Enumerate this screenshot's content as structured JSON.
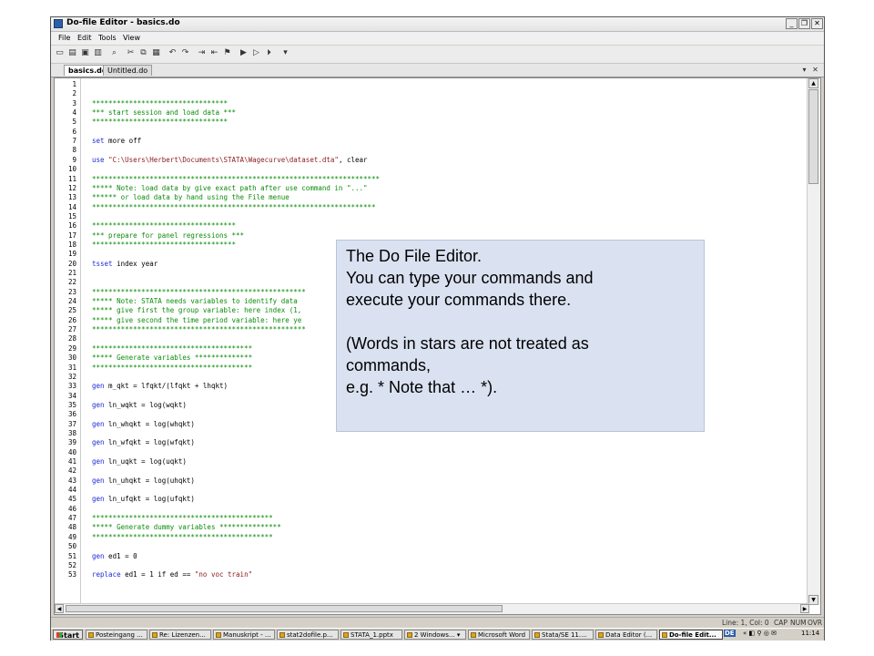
{
  "window": {
    "title": "Do-file Editor - basics.do",
    "min_label": "_",
    "restore_label": "❐",
    "close_label": "✕"
  },
  "menu": [
    "File",
    "Edit",
    "Tools",
    "View"
  ],
  "tabs": [
    {
      "label": "basics.do",
      "active": true
    },
    {
      "label": "Untitled.do",
      "active": false
    }
  ],
  "tab_controls": {
    "dropdown": "▾",
    "close": "✕"
  },
  "code_lines": [
    {
      "n": "1",
      "t": "",
      "type": "blank"
    },
    {
      "n": "2",
      "t": "",
      "type": "blank"
    },
    {
      "n": "3",
      "t": "*********************************",
      "type": "comment"
    },
    {
      "n": "4",
      "t": "*** start session and load data ***",
      "type": "comment"
    },
    {
      "n": "5",
      "t": "*********************************",
      "type": "comment"
    },
    {
      "n": "6",
      "t": "",
      "type": "blank"
    },
    {
      "n": "7",
      "t": "set more off",
      "type": "code",
      "kw": "set"
    },
    {
      "n": "8",
      "t": "",
      "type": "blank"
    },
    {
      "n": "9",
      "t": "use \"C:\\Users\\Herbert\\Documents\\STATA\\Wagecurve\\dataset.dta\", clear",
      "type": "code",
      "kw": "use"
    },
    {
      "n": "10",
      "t": "",
      "type": "blank"
    },
    {
      "n": "11",
      "t": "**********************************************************************",
      "type": "comment"
    },
    {
      "n": "12",
      "t": "***** Note: load data by give exact path after use command in \"...\"",
      "type": "comment"
    },
    {
      "n": "13",
      "t": "****** or load data by hand using the File menue",
      "type": "comment"
    },
    {
      "n": "14",
      "t": "*********************************************************************",
      "type": "comment"
    },
    {
      "n": "15",
      "t": "",
      "type": "blank"
    },
    {
      "n": "16",
      "t": "***********************************",
      "type": "comment"
    },
    {
      "n": "17",
      "t": "*** prepare for panel regressions ***",
      "type": "comment"
    },
    {
      "n": "18",
      "t": "***********************************",
      "type": "comment"
    },
    {
      "n": "19",
      "t": "",
      "type": "blank"
    },
    {
      "n": "20",
      "t": "tsset index year",
      "type": "code",
      "kw": "tsset"
    },
    {
      "n": "21",
      "t": "",
      "type": "blank"
    },
    {
      "n": "22",
      "t": "",
      "type": "blank"
    },
    {
      "n": "23",
      "t": "****************************************************",
      "type": "comment"
    },
    {
      "n": "24",
      "t": "***** Note: STATA needs variables to identify data",
      "type": "comment"
    },
    {
      "n": "25",
      "t": "***** give first the group variable: here index (1,",
      "type": "comment"
    },
    {
      "n": "26",
      "t": "***** give second the time period variable: here ye",
      "type": "comment"
    },
    {
      "n": "27",
      "t": "****************************************************",
      "type": "comment"
    },
    {
      "n": "28",
      "t": "",
      "type": "blank"
    },
    {
      "n": "29",
      "t": "***************************************",
      "type": "comment"
    },
    {
      "n": "30",
      "t": "***** Generate variables **************",
      "type": "comment"
    },
    {
      "n": "31",
      "t": "***************************************",
      "type": "comment"
    },
    {
      "n": "32",
      "t": "",
      "type": "blank"
    },
    {
      "n": "33",
      "t": "gen m_qkt = lfqkt/(lfqkt + lhqkt)",
      "type": "code",
      "kw": "gen"
    },
    {
      "n": "34",
      "t": "",
      "type": "blank"
    },
    {
      "n": "35",
      "t": "gen ln_wqkt = log(wqkt)",
      "type": "code",
      "kw": "gen"
    },
    {
      "n": "36",
      "t": "",
      "type": "blank"
    },
    {
      "n": "37",
      "t": "gen ln_whqkt = log(whqkt)",
      "type": "code",
      "kw": "gen"
    },
    {
      "n": "38",
      "t": "",
      "type": "blank"
    },
    {
      "n": "39",
      "t": "gen ln_wfqkt = log(wfqkt)",
      "type": "code",
      "kw": "gen"
    },
    {
      "n": "40",
      "t": "",
      "type": "blank"
    },
    {
      "n": "41",
      "t": "gen ln_uqkt = log(uqkt)",
      "type": "code",
      "kw": "gen"
    },
    {
      "n": "42",
      "t": "",
      "type": "blank"
    },
    {
      "n": "43",
      "t": "gen ln_uhqkt = log(uhqkt)",
      "type": "code",
      "kw": "gen"
    },
    {
      "n": "44",
      "t": "",
      "type": "blank"
    },
    {
      "n": "45",
      "t": "gen ln_ufqkt = log(ufqkt)",
      "type": "code",
      "kw": "gen"
    },
    {
      "n": "46",
      "t": "",
      "type": "blank"
    },
    {
      "n": "47",
      "t": "********************************************",
      "type": "comment"
    },
    {
      "n": "48",
      "t": "***** Generate dummy variables ***************",
      "type": "comment"
    },
    {
      "n": "49",
      "t": "********************************************",
      "type": "comment"
    },
    {
      "n": "50",
      "t": "",
      "type": "blank"
    },
    {
      "n": "51",
      "t": "gen ed1 = 0",
      "type": "code",
      "kw": "gen"
    },
    {
      "n": "52",
      "t": "",
      "type": "blank"
    },
    {
      "n": "53",
      "t": "replace ed1 = 1 if ed == \"no voc train\"",
      "type": "code",
      "kw": "replace"
    }
  ],
  "status": {
    "position": "Line: 1, Col: 0",
    "cap": "CAP",
    "num": "NUM",
    "ovr": "OVR"
  },
  "taskbar": {
    "start": "Start",
    "items": [
      {
        "label": "Posteingang ...",
        "active": false
      },
      {
        "label": "Re: Lizenzen...",
        "active": false
      },
      {
        "label": "Manuskript - ...",
        "active": false
      },
      {
        "label": "stat2dofile.p...",
        "active": false
      },
      {
        "label": "STATA_1.pptx",
        "active": false
      },
      {
        "label": "2 Windows... ▾",
        "active": false
      },
      {
        "label": "Microsoft Word",
        "active": false
      },
      {
        "label": "Stata/SE 11....",
        "active": false
      },
      {
        "label": "Data Editor (...",
        "active": false
      },
      {
        "label": "Do-file Edit...",
        "active": true
      }
    ],
    "lang": "DE",
    "time": "11:14"
  },
  "callout": {
    "lines": [
      "The Do File Editor.",
      "You can type your commands and",
      "execute your commands there.",
      "",
      "(Words in stars are not treated as",
      "commands,",
      "e.g. * Note that … *)."
    ]
  },
  "colors": {
    "comment": "#0a8c0a",
    "keyword": "#1c2bd6",
    "string": "#8b1a1a",
    "callout_bg": "#dae2f1"
  }
}
